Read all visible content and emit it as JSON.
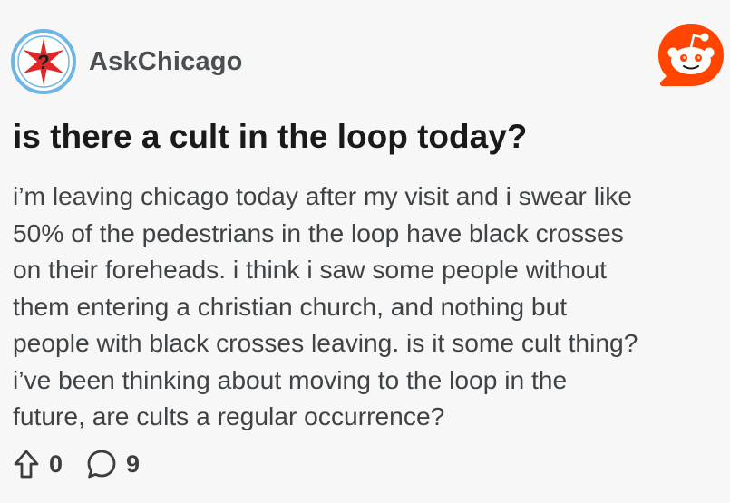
{
  "post": {
    "subreddit": "AskChicago",
    "title": "is there a cult in the loop today?",
    "body_lines": [
      "i’m leaving chicago today after my visit and i swear like",
      "50% of the pedestrians in the loop have black crosses",
      "on their foreheads. i think i saw some people without",
      "them entering a christian church, and nothing but",
      "people with black crosses leaving. is it some cult thing?",
      "i’ve been thinking about moving to the loop in the",
      "future, are cults a regular occurrence?"
    ],
    "upvote_count": "0",
    "comment_count": "9",
    "avatar_glyph": "?"
  },
  "icons": {
    "subreddit_avatar": "chicago-star-icon",
    "app_logo": "reddit-logo-icon",
    "upvote": "upvote-arrow-icon",
    "comments": "comment-bubble-icon"
  },
  "colors": {
    "reddit_orange": "#ff4500",
    "chicago_blue": "#6fb6e2",
    "chicago_red": "#e02828",
    "page_background": "#f7f7f7"
  }
}
